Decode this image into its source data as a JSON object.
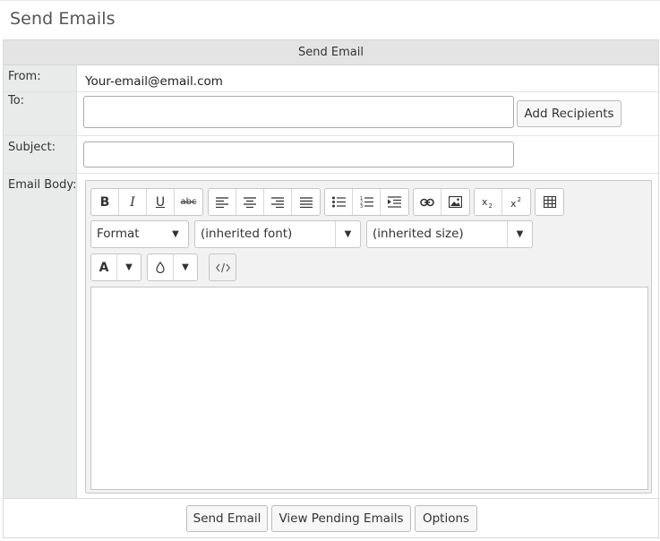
{
  "page": {
    "title": "Send Emails"
  },
  "panel": {
    "header": "Send Email"
  },
  "fields": {
    "from_label": "From:",
    "from_value": "Your-email@email.com",
    "to_label": "To:",
    "to_value": "",
    "add_recipients_label": "Add Recipients",
    "subject_label": "Subject:",
    "subject_value": "",
    "body_label": "Email Body:"
  },
  "toolbar": {
    "bold": "B",
    "italic": "I",
    "underline": "U",
    "strike": "abc",
    "text_color": "A",
    "format_label": "Format",
    "font_label": "(inherited font)",
    "size_label": "(inherited size)",
    "icons": [
      "bold-icon",
      "italic-icon",
      "underline-icon",
      "strikethrough-icon",
      "align-left-icon",
      "align-center-icon",
      "align-right-icon",
      "align-justify-icon",
      "bullet-list-icon",
      "numbered-list-icon",
      "indent-icon",
      "link-icon",
      "image-icon",
      "subscript-icon",
      "superscript-icon",
      "table-icon",
      "text-color-icon",
      "background-color-icon",
      "source-code-icon"
    ]
  },
  "buttons": {
    "send": "Send Email",
    "pending": "View Pending Emails",
    "options": "Options"
  },
  "colors": {
    "label_column": "#e9eaea",
    "header_bg": "#e4e4e4",
    "editor_bg": "#f2f2f2"
  }
}
